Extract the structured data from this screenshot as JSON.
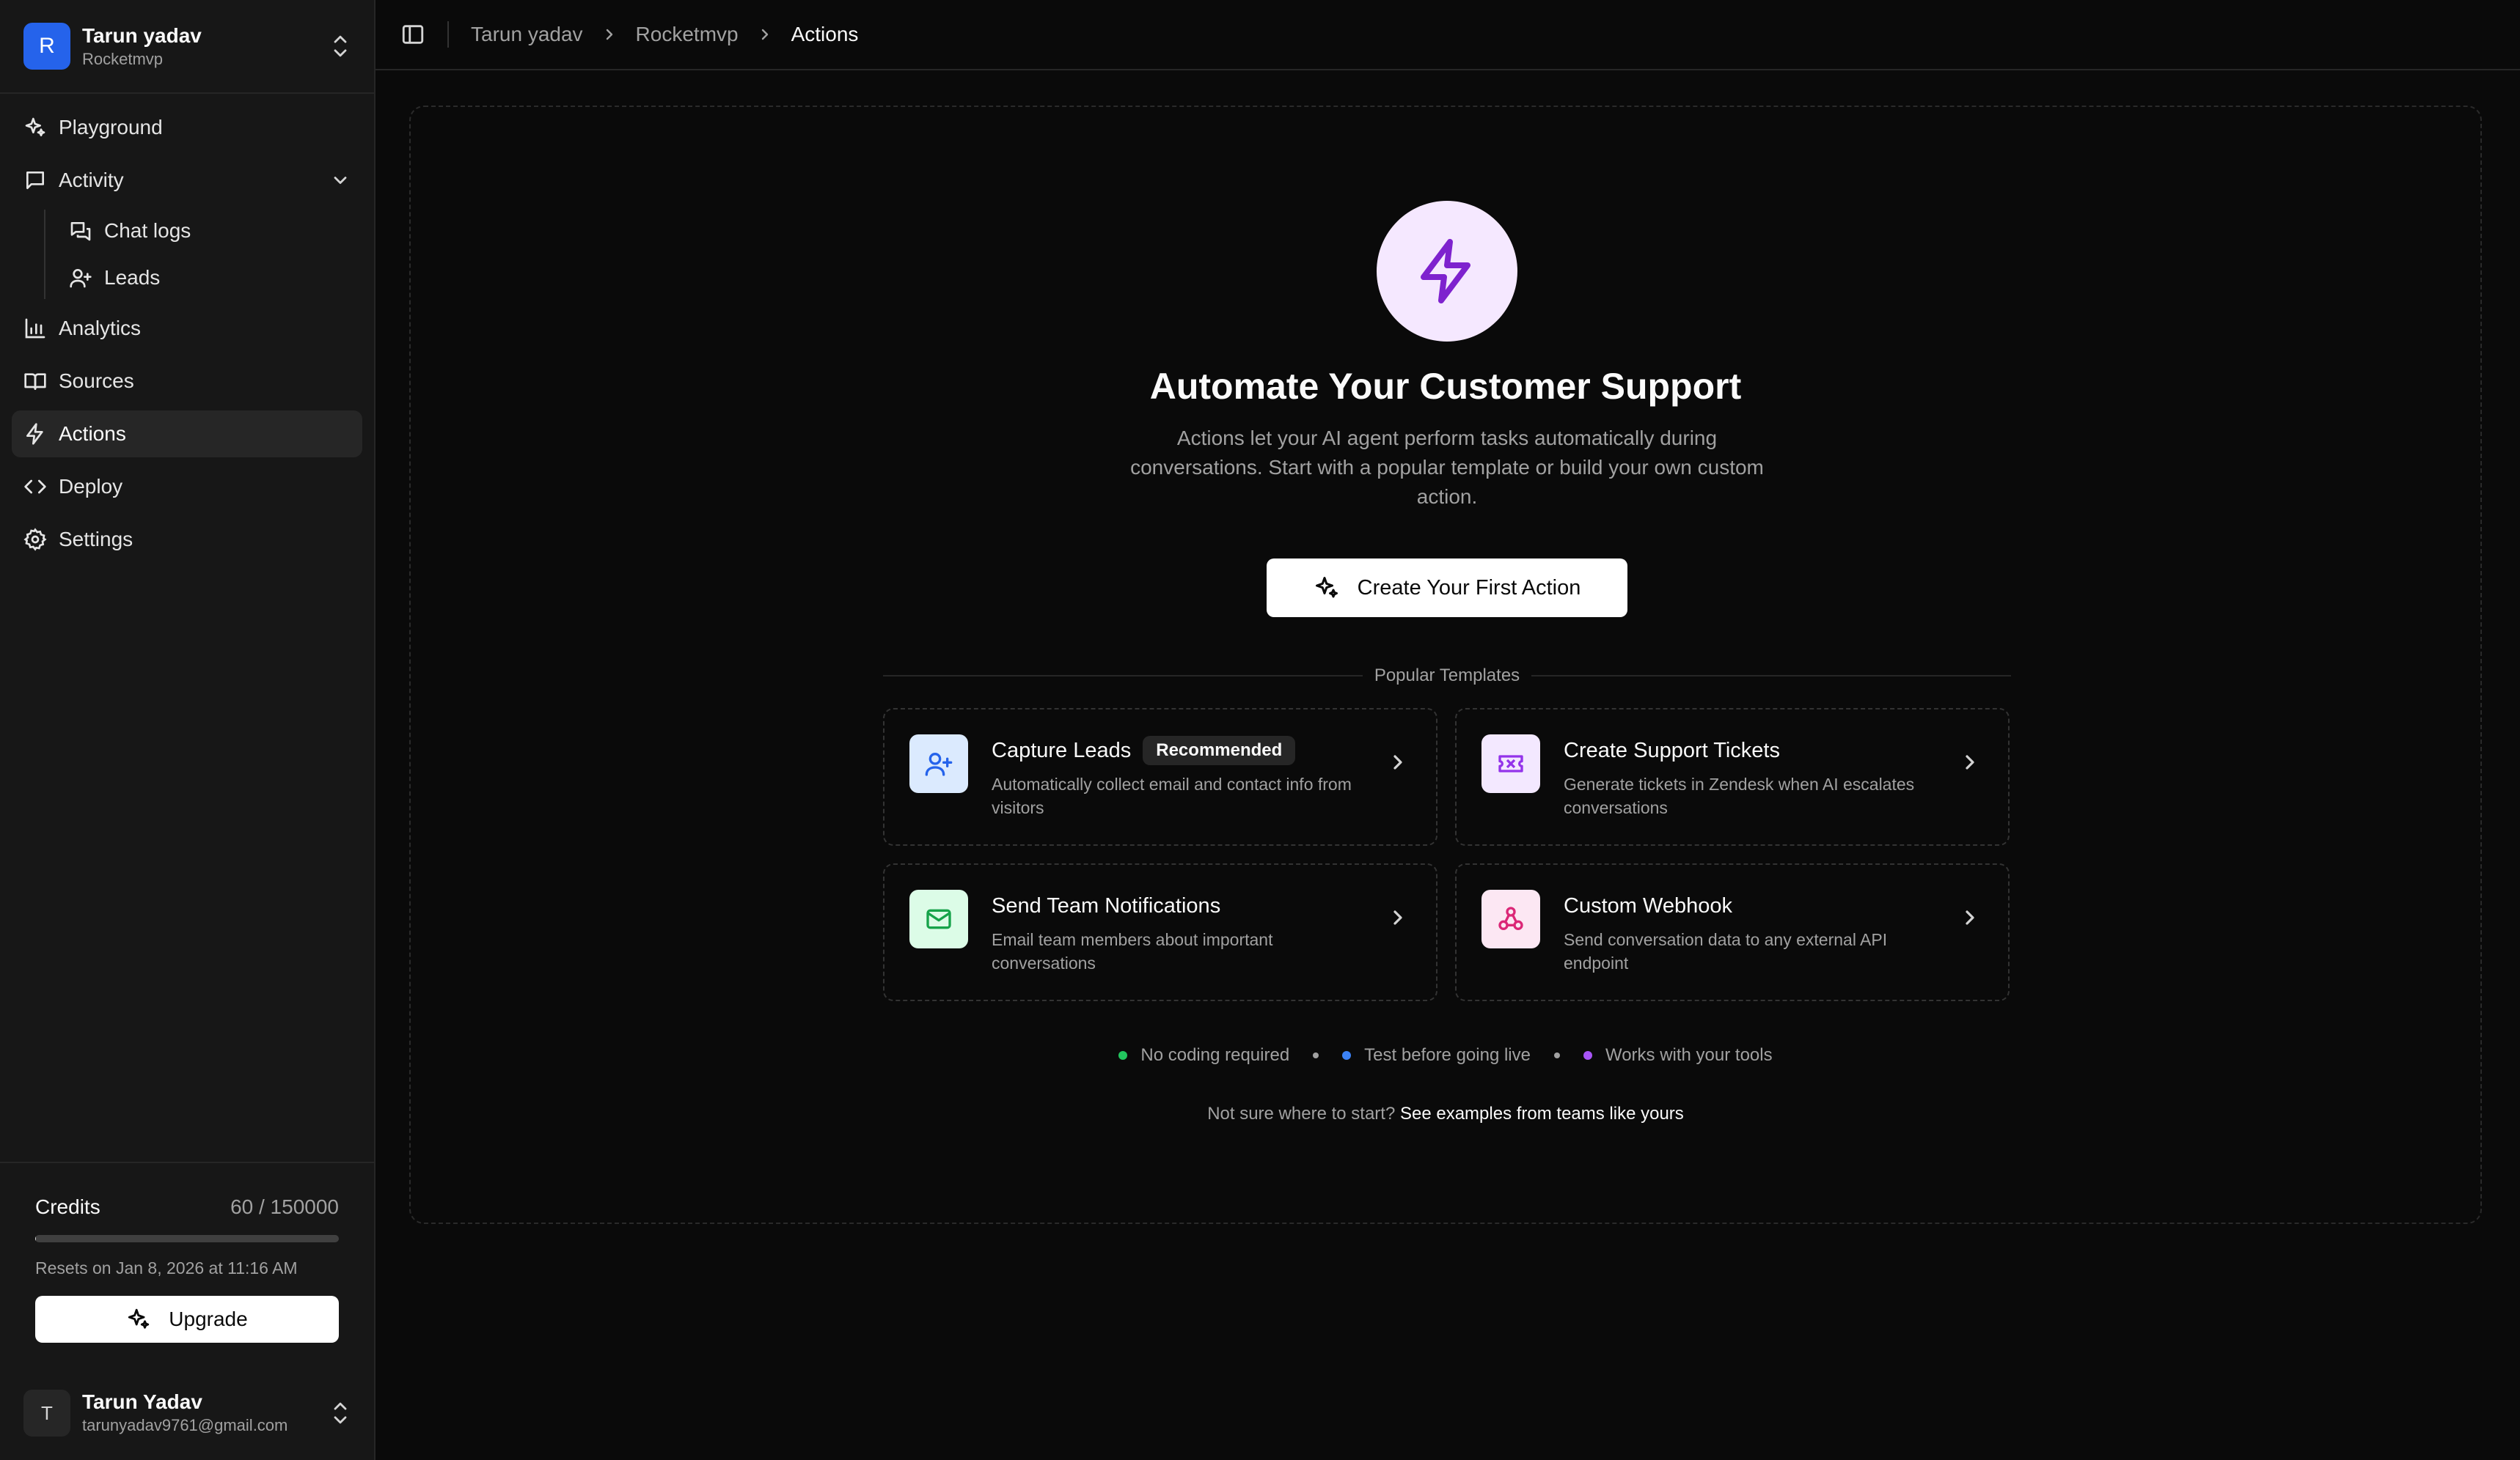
{
  "workspace": {
    "initial": "R",
    "name": "Tarun yadav",
    "sub": "Rocketmvp"
  },
  "nav": {
    "playground": "Playground",
    "activity": "Activity",
    "chat_logs": "Chat logs",
    "leads": "Leads",
    "analytics": "Analytics",
    "sources": "Sources",
    "actions": "Actions",
    "deploy": "Deploy",
    "settings": "Settings"
  },
  "credits": {
    "label": "Credits",
    "value": "60 / 150000",
    "used_fraction": 0.0004,
    "reset": "Resets on Jan 8, 2026 at 11:16 AM",
    "upgrade": "Upgrade"
  },
  "user": {
    "initial": "T",
    "name": "Tarun Yadav",
    "email": "tarunyadav9761@gmail.com"
  },
  "breadcrumb": [
    "Tarun yadav",
    "Rocketmvp",
    "Actions"
  ],
  "hero": {
    "title": "Automate Your Customer Support",
    "description": "Actions let your AI agent perform tasks automatically during conversations. Start with a popular template or build your own custom action.",
    "cta": "Create Your First Action"
  },
  "templates": {
    "heading": "Popular Templates",
    "items": [
      {
        "title": "Capture Leads",
        "badge": "Recommended",
        "description": "Automatically collect email and contact info from visitors",
        "icon": "user-plus-icon",
        "icon_bg": "#dbeafe",
        "icon_color": "#2563eb"
      },
      {
        "title": "Create Support Tickets",
        "description": "Generate tickets in Zendesk when AI escalates conversations",
        "icon": "ticket-icon",
        "icon_bg": "#f3e8ff",
        "icon_color": "#9333ea"
      },
      {
        "title": "Send Team Notifications",
        "description": "Email team members about important conversations",
        "icon": "mail-icon",
        "icon_bg": "#dcfce7",
        "icon_color": "#16a34a"
      },
      {
        "title": "Custom Webhook",
        "description": "Send conversation data to any external API endpoint",
        "icon": "webhook-icon",
        "icon_bg": "#fce7f3",
        "icon_color": "#db2777"
      }
    ]
  },
  "features": [
    {
      "label": "No coding required",
      "color": "#22c55e"
    },
    {
      "label": "Test before going live",
      "color": "#3b82f6"
    },
    {
      "label": "Works with your tools",
      "color": "#a855f7"
    }
  ],
  "help": {
    "prefix": "Not sure where to start?",
    "link": "See examples from teams like yours"
  }
}
